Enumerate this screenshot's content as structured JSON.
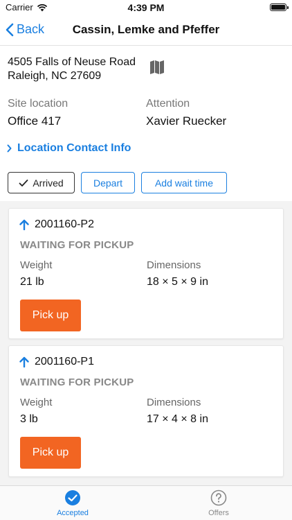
{
  "status_bar": {
    "carrier": "Carrier",
    "time": "4:39 PM"
  },
  "nav": {
    "back_label": "Back",
    "title": "Cassin, Lemke and Pfeffer"
  },
  "address": {
    "line1": "4505 Falls of Neuse Road",
    "line2": "Raleigh, NC 27609"
  },
  "site": {
    "label": "Site location",
    "value": "Office 417"
  },
  "attention": {
    "label": "Attention",
    "value": "Xavier Ruecker"
  },
  "contact_link": "Location Contact Info",
  "actions": {
    "arrived": "Arrived",
    "depart": "Depart",
    "add_wait": "Add wait time"
  },
  "packages": [
    {
      "id": "2001160-P2",
      "status": "WAITING FOR PICKUP",
      "weight_label": "Weight",
      "weight": "21 lb",
      "dimensions_label": "Dimensions",
      "dimensions": "18 × 5 × 9 in",
      "button": "Pick up"
    },
    {
      "id": "2001160-P1",
      "status": "WAITING FOR PICKUP",
      "weight_label": "Weight",
      "weight": "3 lb",
      "dimensions_label": "Dimensions",
      "dimensions": "17 × 4 × 8 in",
      "button": "Pick up"
    }
  ],
  "tabs": [
    {
      "label": "Accepted",
      "icon": "check-circle-icon",
      "active": true
    },
    {
      "label": "Offers",
      "icon": "question-circle-icon",
      "active": false
    }
  ],
  "colors": {
    "accent": "#1a7fe0",
    "pickup": "#f26522",
    "muted": "#888888"
  }
}
